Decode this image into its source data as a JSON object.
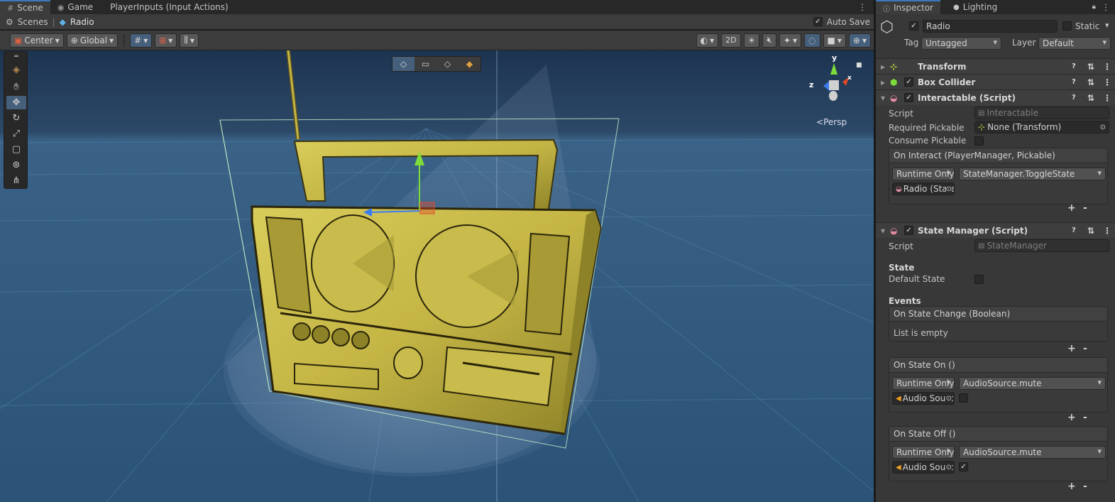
{
  "scene_view": {
    "tabs": [
      "Scene",
      "Game",
      "PlayerInputs (Input Actions)"
    ],
    "breadcrumb": {
      "root": "Scenes",
      "current": "Radio"
    },
    "auto_save_label": "Auto Save",
    "toolbar": {
      "pivot": "Center",
      "space": "Global",
      "mode_2d": "2D"
    },
    "persp_label": "Persp",
    "gizmo_axes": {
      "x": "x",
      "y": "y",
      "z": "z"
    }
  },
  "inspector": {
    "tabs": [
      "Inspector",
      "Lighting"
    ],
    "object_name": "Radio",
    "static_label": "Static",
    "tag_label": "Tag",
    "tag_value": "Untagged",
    "layer_label": "Layer",
    "layer_value": "Default",
    "components": {
      "transform": "Transform",
      "box_collider": "Box Collider",
      "interactable": {
        "title": "Interactable (Script)",
        "script_label": "Script",
        "script_value": "Interactable",
        "required_pickable_label": "Required Pickable",
        "required_pickable_value": "None (Transform)",
        "consume_pickable_label": "Consume Pickable",
        "on_interact": {
          "header": "On Interact (PlayerManager, Pickable)",
          "mode": "Runtime Only",
          "function": "StateManager.ToggleState",
          "target": "Radio (State Manager)"
        }
      },
      "state_manager": {
        "title": "State Manager (Script)",
        "script_label": "Script",
        "script_value": "StateManager",
        "state_heading": "State",
        "default_state_label": "Default State",
        "events_heading": "Events",
        "on_state_change": {
          "header": "On State Change (Boolean)",
          "empty_text": "List is empty"
        },
        "on_state_on": {
          "header": "On State On ()",
          "mode": "Runtime Only",
          "function": "AudioSource.mute",
          "target": "Audio Source (Audio Source)"
        },
        "on_state_off": {
          "header": "On State Off ()",
          "mode": "Runtime Only",
          "function": "AudioSource.mute",
          "target": "Audio Source (Audio Source)"
        }
      }
    },
    "plus": "+",
    "minus": "-"
  }
}
